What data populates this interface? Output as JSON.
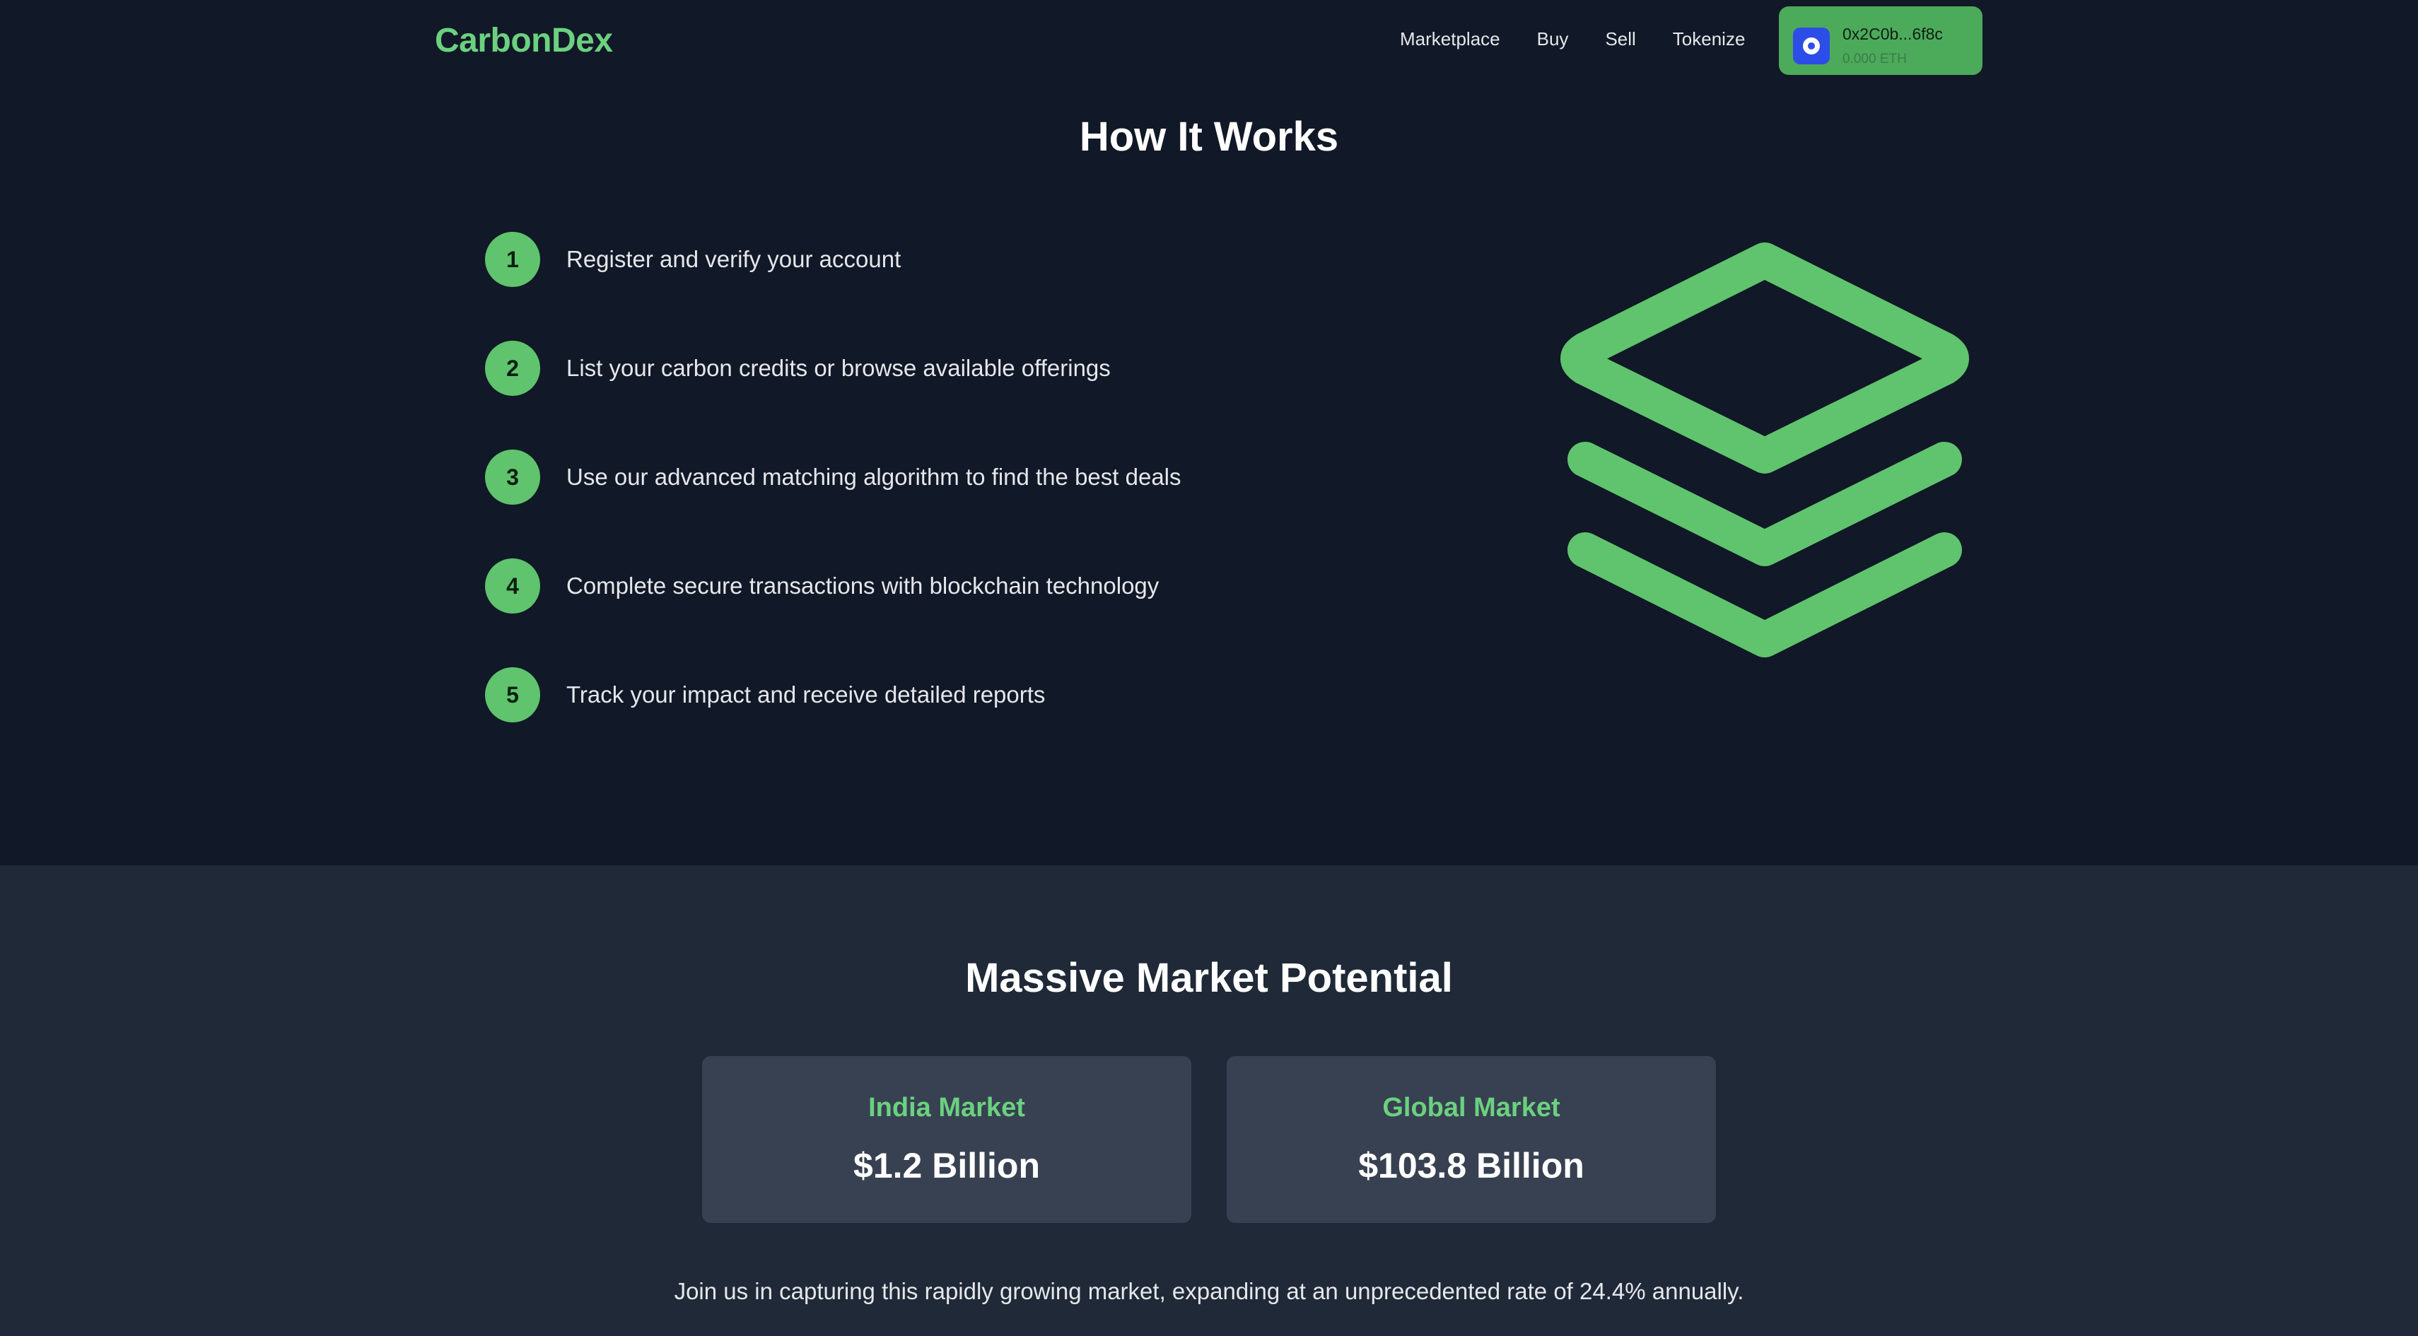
{
  "header": {
    "logo": "CarbonDex",
    "nav": [
      {
        "label": "Marketplace"
      },
      {
        "label": "Buy"
      },
      {
        "label": "Sell"
      },
      {
        "label": "Tokenize"
      }
    ],
    "wallet": {
      "address": "0x2C0b...6f8c",
      "balance": "0.000 ETH",
      "color": "#4caa5b"
    }
  },
  "how_it_works": {
    "title": "How It Works",
    "steps": [
      {
        "number": "1",
        "text": "Register and verify your account"
      },
      {
        "number": "2",
        "text": "List your carbon credits or browse available offerings"
      },
      {
        "number": "3",
        "text": "Use our advanced matching algorithm to find the best deals"
      },
      {
        "number": "4",
        "text": "Complete secure transactions with blockchain technology"
      },
      {
        "number": "5",
        "text": "Track your impact and receive detailed reports"
      }
    ],
    "illustration_icon": "layers-icon"
  },
  "market": {
    "title": "Massive Market Potential",
    "cards": [
      {
        "label": "India Market",
        "value": "$1.2 Billion"
      },
      {
        "label": "Global Market",
        "value": "$103.8 Billion"
      }
    ],
    "note": "Join us in capturing this rapidly growing market, expanding at an unprecedented rate of 24.4% annually."
  },
  "colors": {
    "accent": "#5fc46d",
    "background": "#111827",
    "section_background": "#1f2937",
    "card_background": "#374151"
  }
}
